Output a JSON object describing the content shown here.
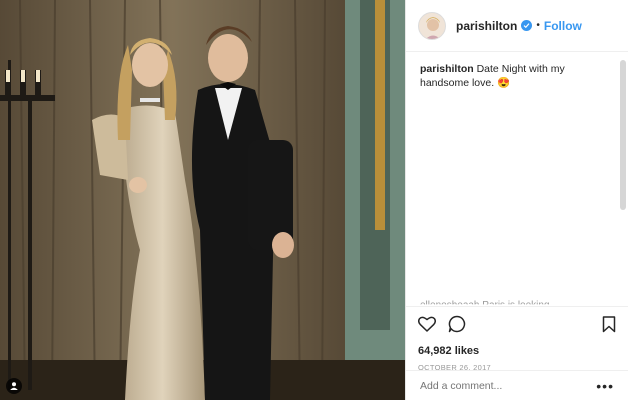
{
  "post": {
    "username": "parishilton",
    "follow_label": "Follow",
    "separator": "•",
    "caption_text": "Date Night with my handsome love. 😍",
    "likes": "64,982 likes",
    "date": "OCTOBER 26, 2017",
    "comment_placeholder": "Add a comment...",
    "more_label": "•••",
    "partial_comment": "ellenosheaah Paris is looking"
  },
  "icons": {
    "verified": "verified-badge-icon",
    "like": "heart-icon",
    "comment": "speech-bubble-icon",
    "save": "bookmark-icon",
    "tagged": "person-icon"
  },
  "colors": {
    "accent": "#3897f0",
    "text": "#262626",
    "muted": "#999999"
  }
}
